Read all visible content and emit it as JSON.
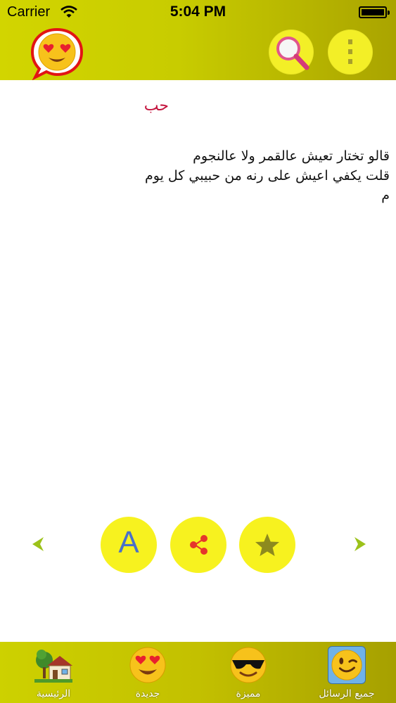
{
  "status_bar": {
    "carrier": "Carrier",
    "time": "5:04 PM"
  },
  "header": {
    "app_icon": "heart-eyes-chat-icon",
    "search_icon": "magnifier-icon",
    "menu_icon": "vertical-dots-icon"
  },
  "message": {
    "title": "حب",
    "body": "قالو تختار تعيش عالقمر ولا عالنجوم\nقلت يكفي اعيش على رنه من حبيبي كل يوم\nم"
  },
  "actions": {
    "font_label": "A",
    "prev_icon": "chevron-left-icon",
    "next_icon": "chevron-right-icon",
    "share_icon": "share-icon",
    "favorite_icon": "star-icon"
  },
  "tabs": [
    {
      "label": "الرئيسية",
      "icon": "house-icon"
    },
    {
      "label": "جديدة",
      "icon": "heart-eyes-emoji-icon"
    },
    {
      "label": "مميزة",
      "icon": "sunglasses-emoji-icon"
    },
    {
      "label": "جميع الرسائل",
      "icon": "wink-emoji-icon"
    }
  ],
  "colors": {
    "header": "#c8cc00",
    "button": "#f3ef27",
    "title": "#c4123c",
    "accent_arrow": "#9cc21a"
  }
}
